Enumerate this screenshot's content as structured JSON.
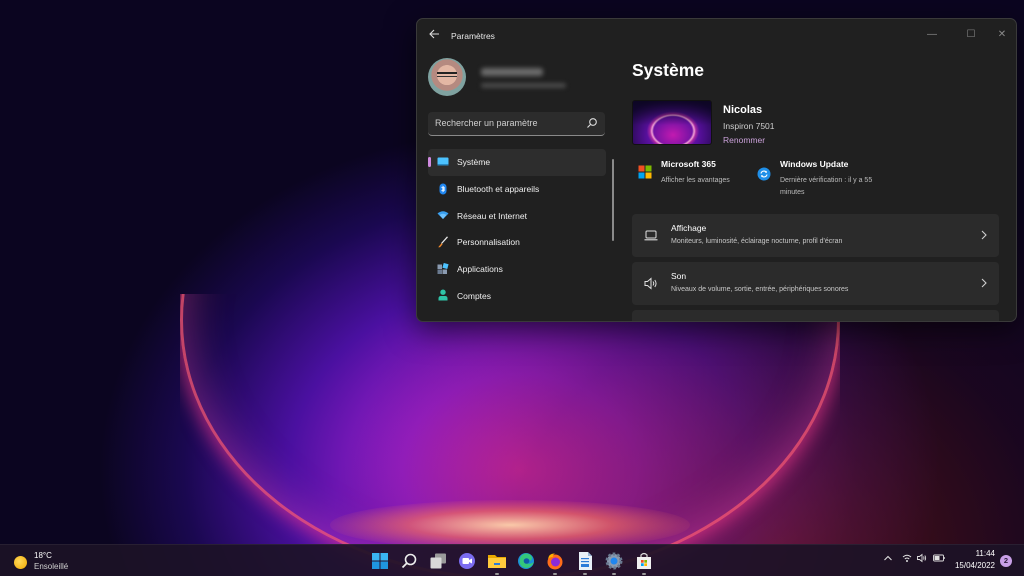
{
  "window": {
    "title": "Paramètres",
    "controls": {
      "minimize": "—",
      "maximize": "☐",
      "close": "✕"
    }
  },
  "nav": {
    "search_placeholder": "Rechercher un paramètre",
    "items": [
      {
        "label": "Système",
        "icon": "monitor-icon",
        "active": true
      },
      {
        "label": "Bluetooth et appareils",
        "icon": "bluetooth-icon"
      },
      {
        "label": "Réseau et Internet",
        "icon": "wifi-icon"
      },
      {
        "label": "Personnalisation",
        "icon": "brush-icon"
      },
      {
        "label": "Applications",
        "icon": "apps-icon"
      },
      {
        "label": "Comptes",
        "icon": "person-icon"
      }
    ]
  },
  "main": {
    "title": "Système",
    "device": {
      "name": "Nicolas",
      "model": "Inspiron 7501",
      "rename": "Renommer"
    },
    "tiles": [
      {
        "title": "Microsoft 365",
        "subtitle": "Afficher les avantages"
      },
      {
        "title": "Windows Update",
        "subtitle": "Dernière vérification : il y a 55 minutes"
      }
    ],
    "cards": [
      {
        "title": "Affichage",
        "subtitle": "Moniteurs, luminosité, éclairage nocturne, profil d'écran"
      },
      {
        "title": "Son",
        "subtitle": "Niveaux de volume, sortie, entrée, périphériques sonores"
      }
    ]
  },
  "taskbar": {
    "weather": {
      "temp": "18°C",
      "condition": "Ensoleillé"
    },
    "apps": [
      "start",
      "search",
      "task-view",
      "teams-chat",
      "file-explorer",
      "edge",
      "firefox",
      "document",
      "settings",
      "store"
    ],
    "clock": {
      "time": "11:44",
      "date": "15/04/2022"
    },
    "notifications": "2"
  },
  "colors": {
    "accent": "#d08ae0",
    "window_bg": "#202020",
    "card_bg": "#2b2b2b"
  }
}
